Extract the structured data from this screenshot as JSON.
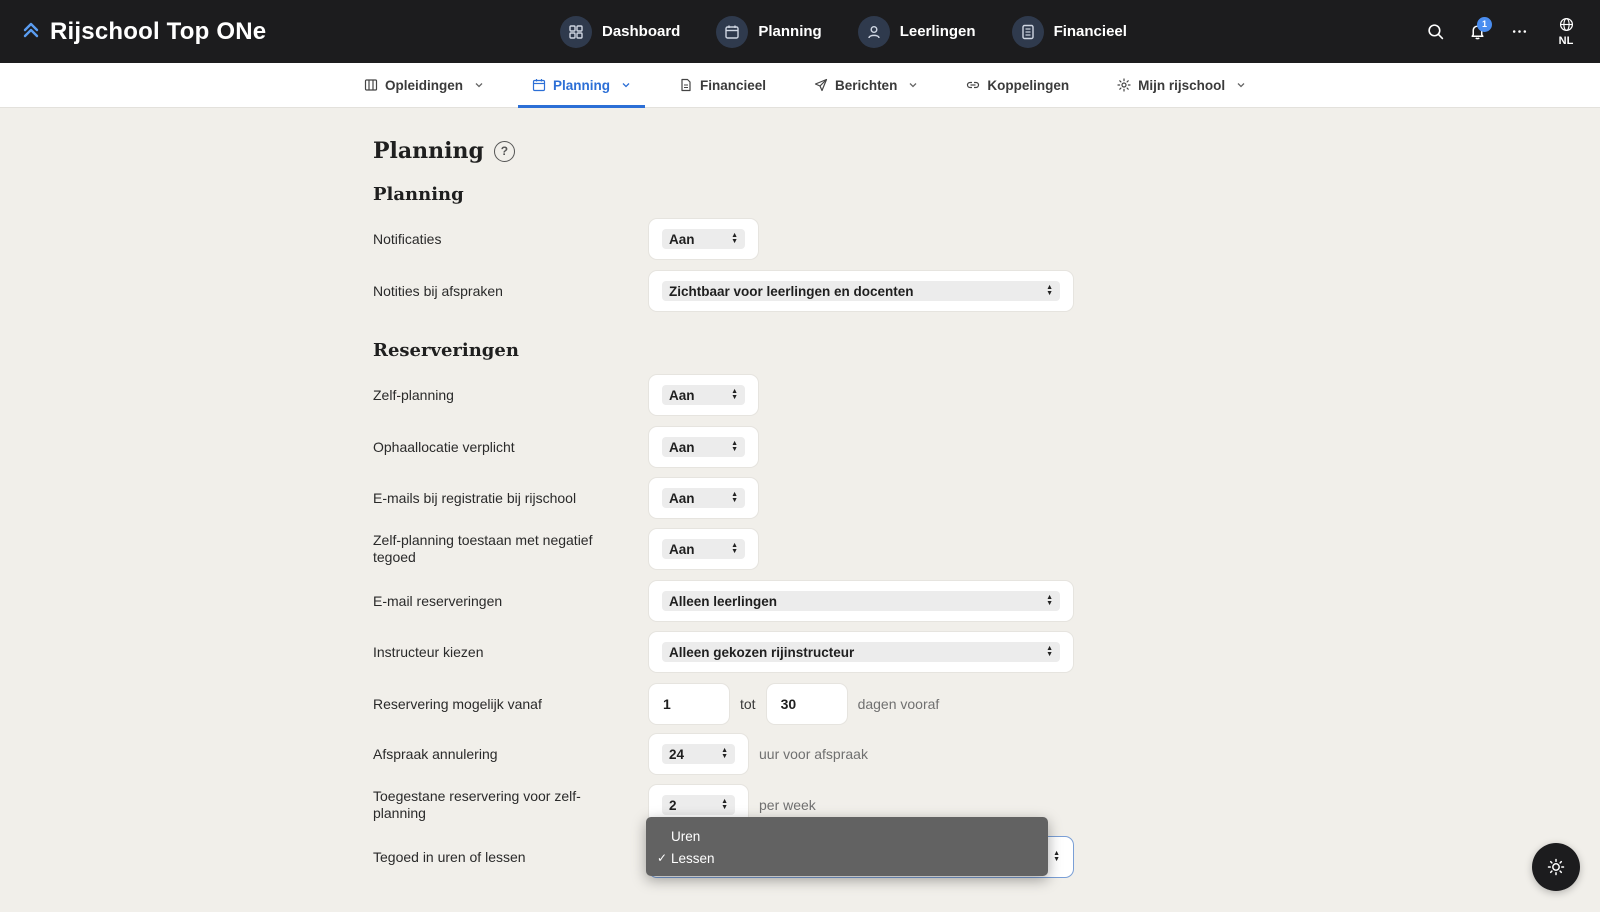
{
  "brand": {
    "title": "Rijschool Top ONe"
  },
  "main_nav": [
    {
      "label": "Dashboard",
      "icon": "dashboard-icon"
    },
    {
      "label": "Planning",
      "icon": "calendar-icon"
    },
    {
      "label": "Leerlingen",
      "icon": "user-icon"
    },
    {
      "label": "Financieel",
      "icon": "document-icon"
    }
  ],
  "top_actions": {
    "notification_count": "1",
    "language": "NL"
  },
  "sub_nav": [
    {
      "label": "Opleidingen",
      "icon": "columns-icon"
    },
    {
      "label": "Planning",
      "icon": "calendar-icon",
      "active": true
    },
    {
      "label": "Financieel",
      "icon": "document-icon"
    },
    {
      "label": "Berichten",
      "icon": "send-icon"
    },
    {
      "label": "Koppelingen",
      "icon": "link-icon"
    },
    {
      "label": "Mijn rijschool",
      "icon": "gear-icon"
    }
  ],
  "page": {
    "title": "Planning",
    "help_glyph": "?",
    "section_planning": "Planning",
    "section_reserveringen": "Reserveringen"
  },
  "settings": {
    "notificaties": {
      "label": "Notificaties",
      "value": "Aan"
    },
    "notities": {
      "label": "Notities bij afspraken",
      "value": "Zichtbaar voor leerlingen en docenten"
    },
    "zelf_planning": {
      "label": "Zelf-planning",
      "value": "Aan"
    },
    "ophaallocatie": {
      "label": "Ophaallocatie verplicht",
      "value": "Aan"
    },
    "emails_registratie": {
      "label": "E-mails bij registratie bij rijschool",
      "value": "Aan"
    },
    "negatief_tegoed": {
      "label": "Zelf-planning toestaan met negatief tegoed",
      "value": "Aan"
    },
    "email_reserveringen": {
      "label": "E-mail reserveringen",
      "value": "Alleen leerlingen"
    },
    "instructeur": {
      "label": "Instructeur kiezen",
      "value": "Alleen gekozen rijinstructeur"
    },
    "reservering_vanaf": {
      "label": "Reservering mogelijk vanaf",
      "from": "1",
      "between": "tot",
      "to": "30",
      "suffix": "dagen vooraf"
    },
    "annulering": {
      "label": "Afspraak annulering",
      "value": "24",
      "suffix": "uur voor afspraak"
    },
    "toegestane": {
      "label": "Toegestane reservering voor zelf-planning",
      "value": "2",
      "suffix": "per week"
    },
    "tegoed": {
      "label": "Tegoed in uren of lessen"
    }
  },
  "dropdown": {
    "options": [
      {
        "label": "Uren",
        "check": ""
      },
      {
        "label": "Lessen",
        "check": "✓"
      }
    ]
  }
}
